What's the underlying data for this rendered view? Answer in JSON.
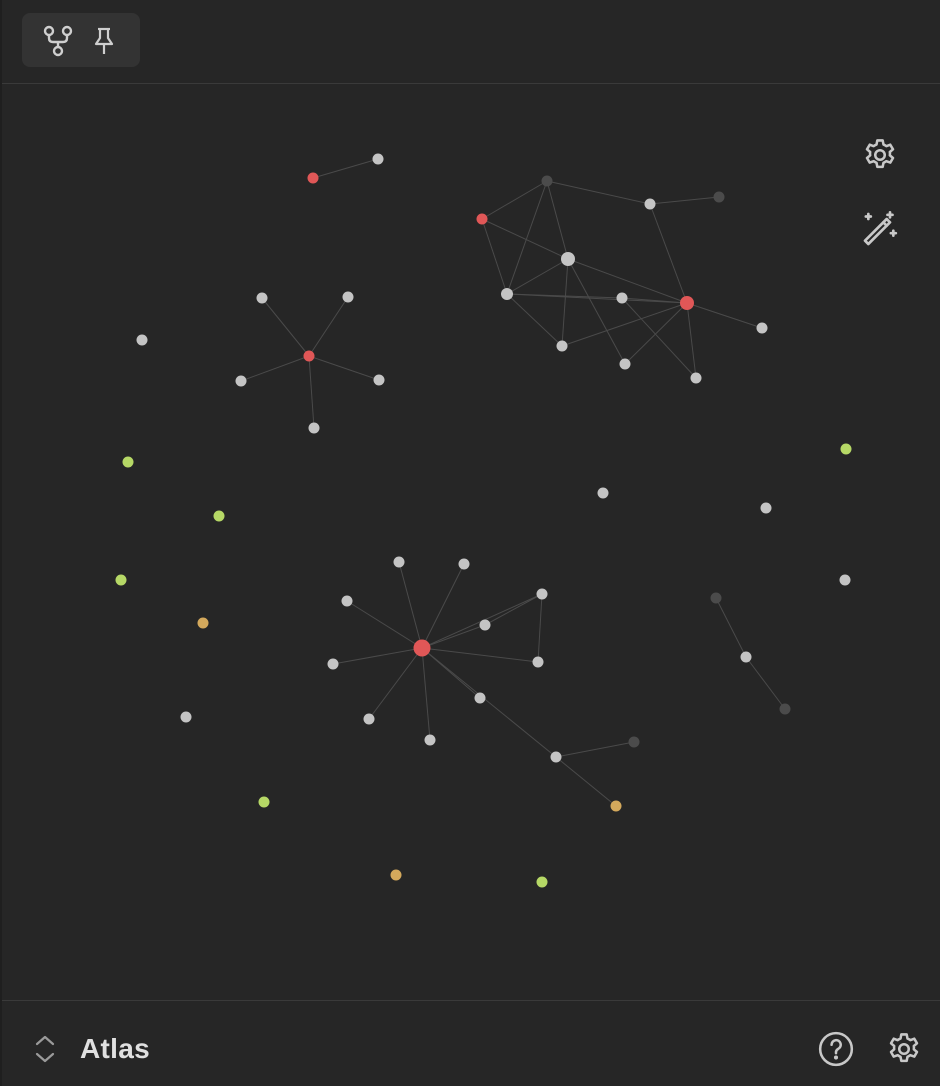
{
  "toolbar": {
    "icons": [
      "graph-view-icon",
      "pin-icon"
    ]
  },
  "graph": {
    "controls": [
      "gear-icon",
      "magic-wand-icon"
    ],
    "colors": {
      "edge": "#4a4a4a",
      "node_default": "#c4c4c4",
      "node_dim": "#4b4b4b",
      "node_tag": "#e05757",
      "node_attachment": "#b6d866",
      "node_orphan": "#d4a95c"
    }
  },
  "footer": {
    "vault_name": "Atlas",
    "icons": [
      "chevron-up-down-icon",
      "help-icon",
      "gear-icon"
    ]
  }
}
